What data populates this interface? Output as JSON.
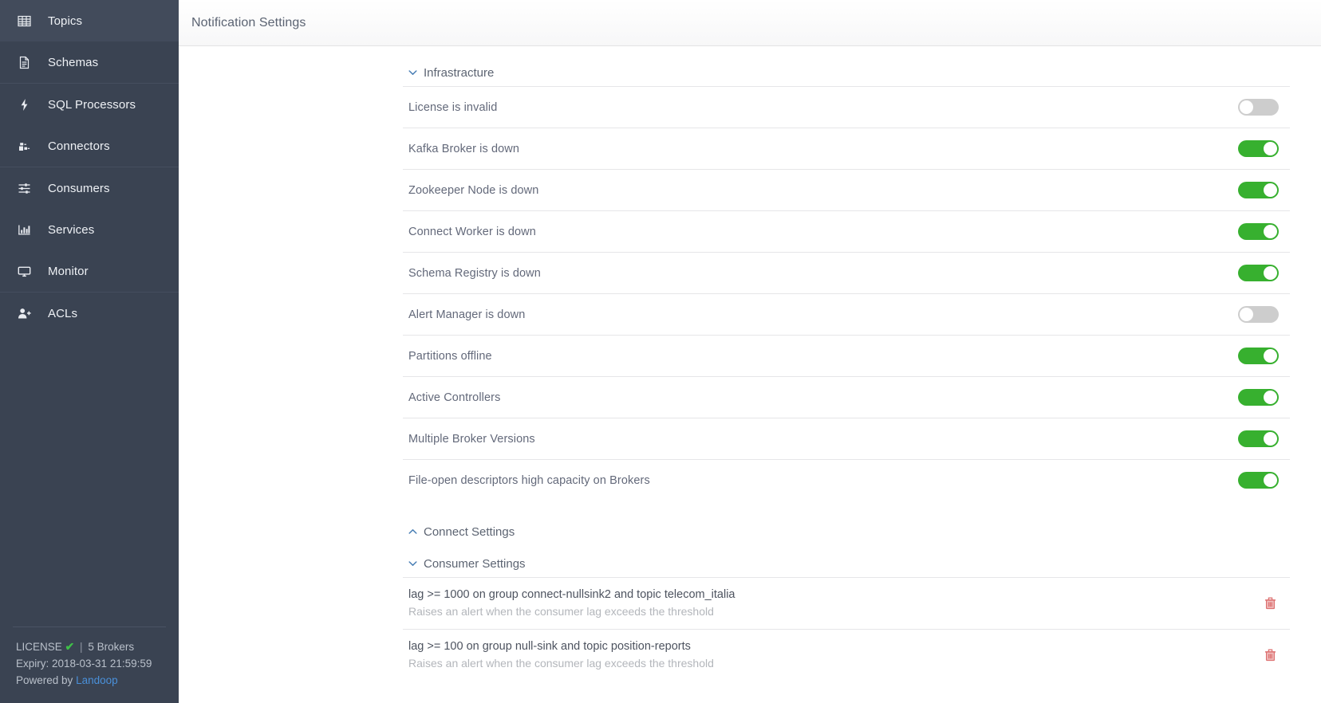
{
  "sidebar": {
    "groups": [
      {
        "items": [
          {
            "label": "Topics",
            "icon": "grid-icon"
          },
          {
            "label": "Schemas",
            "icon": "document-icon"
          }
        ]
      },
      {
        "items": [
          {
            "label": "SQL Processors",
            "icon": "lightning-bolt-icon"
          },
          {
            "label": "Connectors",
            "icon": "connector-plug-icon"
          }
        ]
      },
      {
        "items": [
          {
            "label": "Consumers",
            "icon": "sliders-icon"
          },
          {
            "label": "Services",
            "icon": "bar-chart-icon"
          },
          {
            "label": "Monitor",
            "icon": "monitor-screen-icon"
          }
        ]
      },
      {
        "items": [
          {
            "label": "ACLs",
            "icon": "user-add-icon"
          }
        ]
      }
    ],
    "license": {
      "label": "LICENSE",
      "check_icon": "check-icon",
      "separator": "|",
      "brokers": "5 Brokers",
      "expiry": "Expiry: 2018-03-31 21:59:59",
      "powered_prefix": "Powered by",
      "powered_link": "Landoop"
    }
  },
  "header": {
    "title": "Notification Settings"
  },
  "sections": [
    {
      "title": "Infrastracture",
      "expanded": true,
      "chevron": "chevron-down-icon",
      "rows": [
        {
          "label": "License is invalid",
          "enabled": false
        },
        {
          "label": "Kafka Broker is down",
          "enabled": true
        },
        {
          "label": "Zookeeper Node is down",
          "enabled": true
        },
        {
          "label": "Connect Worker is down",
          "enabled": true
        },
        {
          "label": "Schema Registry is down",
          "enabled": true
        },
        {
          "label": "Alert Manager is down",
          "enabled": false
        },
        {
          "label": "Partitions offline",
          "enabled": true
        },
        {
          "label": "Active Controllers",
          "enabled": true
        },
        {
          "label": "Multiple Broker Versions",
          "enabled": true
        },
        {
          "label": "File-open descriptors high capacity on Brokers",
          "enabled": true
        }
      ]
    },
    {
      "title": "Connect Settings",
      "expanded": false,
      "chevron": "chevron-up-icon",
      "rows": []
    },
    {
      "title": "Consumer Settings",
      "expanded": true,
      "chevron": "chevron-down-icon",
      "consumers": [
        {
          "title": "lag >= 1000 on group connect-nullsink2 and topic telecom_italia",
          "description": "Raises an alert when the consumer lag exceeds the threshold",
          "delete_icon": "trash-icon"
        },
        {
          "title": "lag >= 100 on group null-sink and topic position-reports",
          "description": "Raises an alert when the consumer lag exceeds the threshold",
          "delete_icon": "trash-icon"
        }
      ]
    }
  ],
  "colors": {
    "sidebar_bg": "#3a4352",
    "toggle_on": "#37b02f",
    "toggle_off": "#cdcdcd",
    "accent_link": "#4a90d9",
    "chevron": "#4a7fb5",
    "danger": "#dd7272",
    "license_ok": "#3fbf48"
  }
}
